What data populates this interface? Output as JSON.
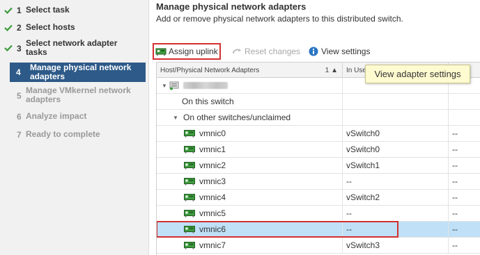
{
  "wizard": {
    "steps": [
      {
        "num": "1",
        "label": "Select task",
        "state": "done"
      },
      {
        "num": "2",
        "label": "Select hosts",
        "state": "done"
      },
      {
        "num": "3",
        "label": "Select network adapter tasks",
        "label_line1": "Select network adapter",
        "label_line2": "tasks",
        "state": "done"
      },
      {
        "num": "4",
        "label": "Manage physical network adapters",
        "label_line1": "Manage physical network",
        "label_line2": "adapters",
        "state": "active"
      },
      {
        "num": "5",
        "label": "Manage VMkernel network adapters",
        "label_line1": "Manage VMkernel network",
        "label_line2": "adapters",
        "state": "disabled"
      },
      {
        "num": "6",
        "label": "Analyze impact",
        "state": "disabled"
      },
      {
        "num": "7",
        "label": "Ready to complete",
        "state": "disabled"
      }
    ]
  },
  "page": {
    "title": "Manage physical network adapters",
    "subtitle": "Add or remove physical network adapters to this distributed switch."
  },
  "toolbar": {
    "assign_uplink": "Assign uplink",
    "reset_changes": "Reset changes",
    "view_settings": "View settings",
    "tooltip": "View adapter settings"
  },
  "grid": {
    "columns": {
      "adapters": "Host/Physical Network Adapters",
      "sort_rank": "1",
      "in_use_by": "In Use"
    },
    "host_label": "172.16.2.16",
    "groups": {
      "on_this_switch": "On this switch",
      "on_other": "On other switches/unclaimed"
    },
    "rows": [
      {
        "name": "vmnic0",
        "in_use": "vSwitch0",
        "uplink": "--"
      },
      {
        "name": "vmnic1",
        "in_use": "vSwitch0",
        "uplink": "--"
      },
      {
        "name": "vmnic2",
        "in_use": "vSwitch1",
        "uplink": "--"
      },
      {
        "name": "vmnic3",
        "in_use": "--",
        "uplink": "--"
      },
      {
        "name": "vmnic4",
        "in_use": "vSwitch2",
        "uplink": "--"
      },
      {
        "name": "vmnic5",
        "in_use": "--",
        "uplink": "--"
      },
      {
        "name": "vmnic6",
        "in_use": "--",
        "uplink": "--",
        "selected": true
      },
      {
        "name": "vmnic7",
        "in_use": "vSwitch3",
        "uplink": "--"
      }
    ]
  },
  "colors": {
    "active_step": "#2d5a88",
    "check_green": "#3c9a3c",
    "highlight_red": "#d32f2f",
    "selected_row": "#bfe0f7",
    "tooltip_bg": "#fffbd0"
  },
  "icons": {
    "done_step": "check-icon",
    "assign_uplink": "network-adapter-assign-icon",
    "reset_changes": "reset-icon",
    "view_settings": "info-icon",
    "host": "host-icon",
    "adapter": "network-adapter-icon"
  }
}
